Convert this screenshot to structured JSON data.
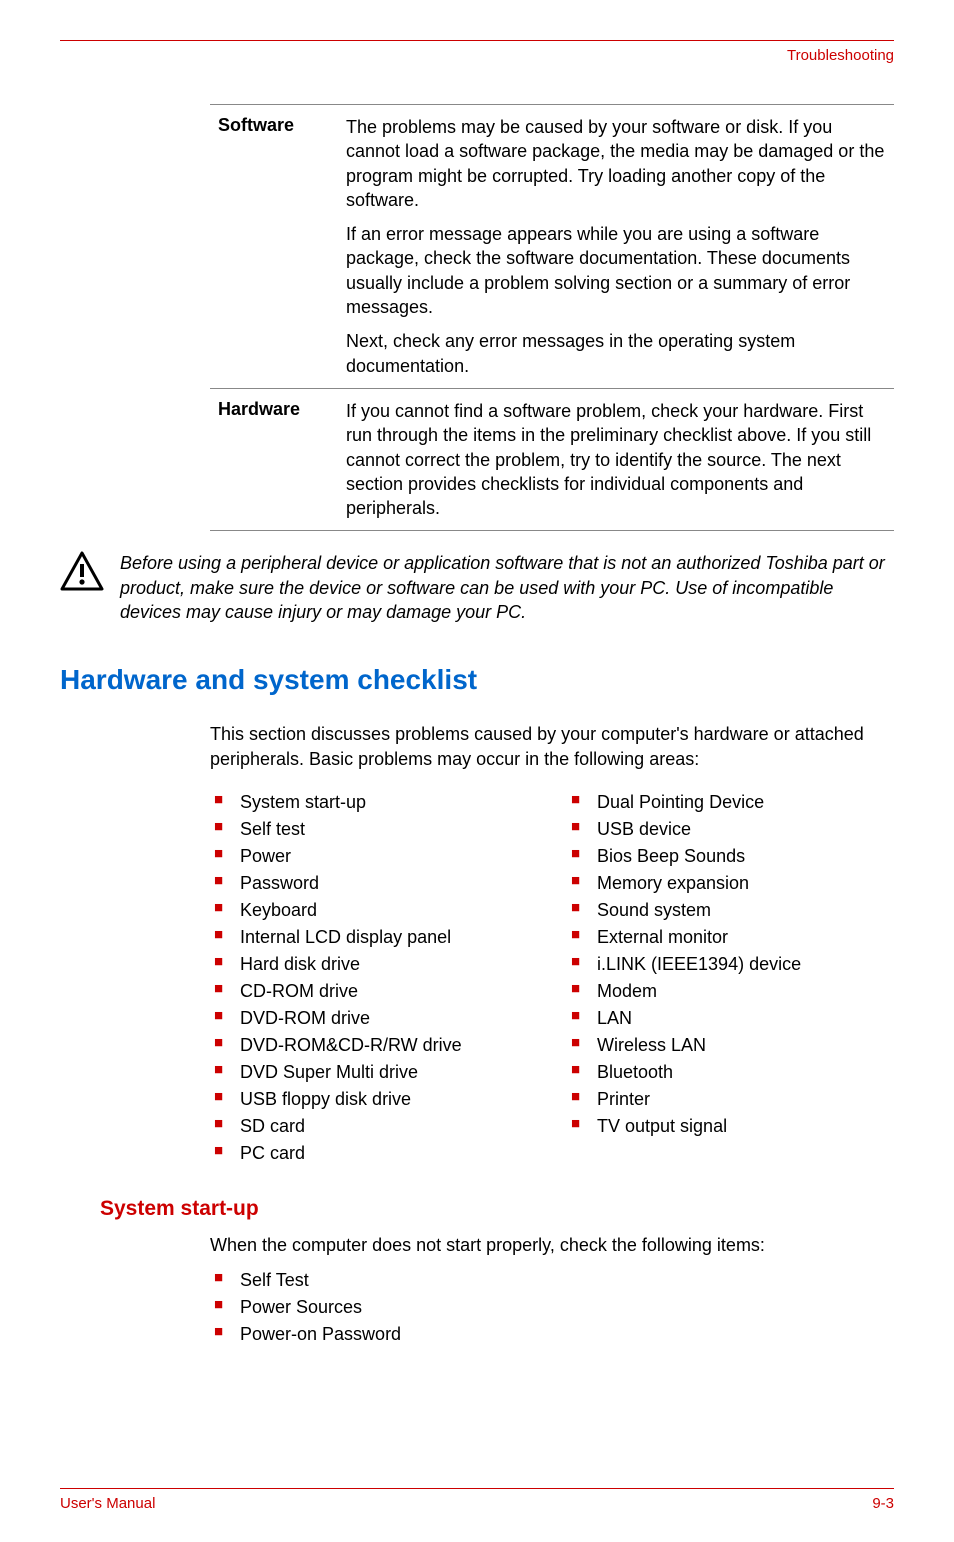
{
  "header": {
    "right": "Troubleshooting"
  },
  "table": {
    "rows": [
      {
        "label": "Software",
        "paras": [
          "The problems may be caused by your software or disk. If you cannot load a software package, the media may be damaged or the program might be corrupted. Try loading another copy of the software.",
          "If an error message appears while you are using a software package, check the software documentation. These documents usually include a problem solving section or a summary of error messages.",
          "Next, check any error messages in the operating system documentation."
        ]
      },
      {
        "label": "Hardware",
        "paras": [
          "If you cannot find a software problem, check your hardware. First run through the items in the preliminary checklist above. If you still cannot correct the problem, try to identify the source. The next section provides checklists for individual components and peripherals."
        ]
      }
    ]
  },
  "note": "Before using a peripheral device or application software that is not an authorized Toshiba part or product, make sure the device or software can be used with your PC. Use of incompatible devices may cause injury or may damage your PC.",
  "section": {
    "title": "Hardware and system checklist",
    "intro": "This section discusses problems caused by your computer's hardware or attached peripherals. Basic problems may occur in the following areas:",
    "col1": [
      "System start-up",
      "Self test",
      "Power",
      "Password",
      "Keyboard",
      "Internal LCD display panel",
      "Hard disk drive",
      "CD-ROM drive",
      "DVD-ROM drive",
      "DVD-ROM&CD-R/RW drive",
      "DVD Super Multi drive",
      "USB floppy disk drive",
      "SD card",
      "PC card"
    ],
    "col2": [
      "Dual Pointing Device",
      "USB device",
      "Bios Beep Sounds",
      "Memory expansion",
      "Sound system",
      "External monitor",
      "i.LINK (IEEE1394) device",
      "Modem",
      "LAN",
      "Wireless LAN",
      "Bluetooth",
      "Printer",
      "TV output signal"
    ]
  },
  "sub": {
    "title": "System start-up",
    "intro": "When the computer does not start properly, check the following items:",
    "items": [
      "Self Test",
      "Power Sources",
      "Power-on Password"
    ]
  },
  "footer": {
    "left": "User's Manual",
    "right": "9-3"
  }
}
